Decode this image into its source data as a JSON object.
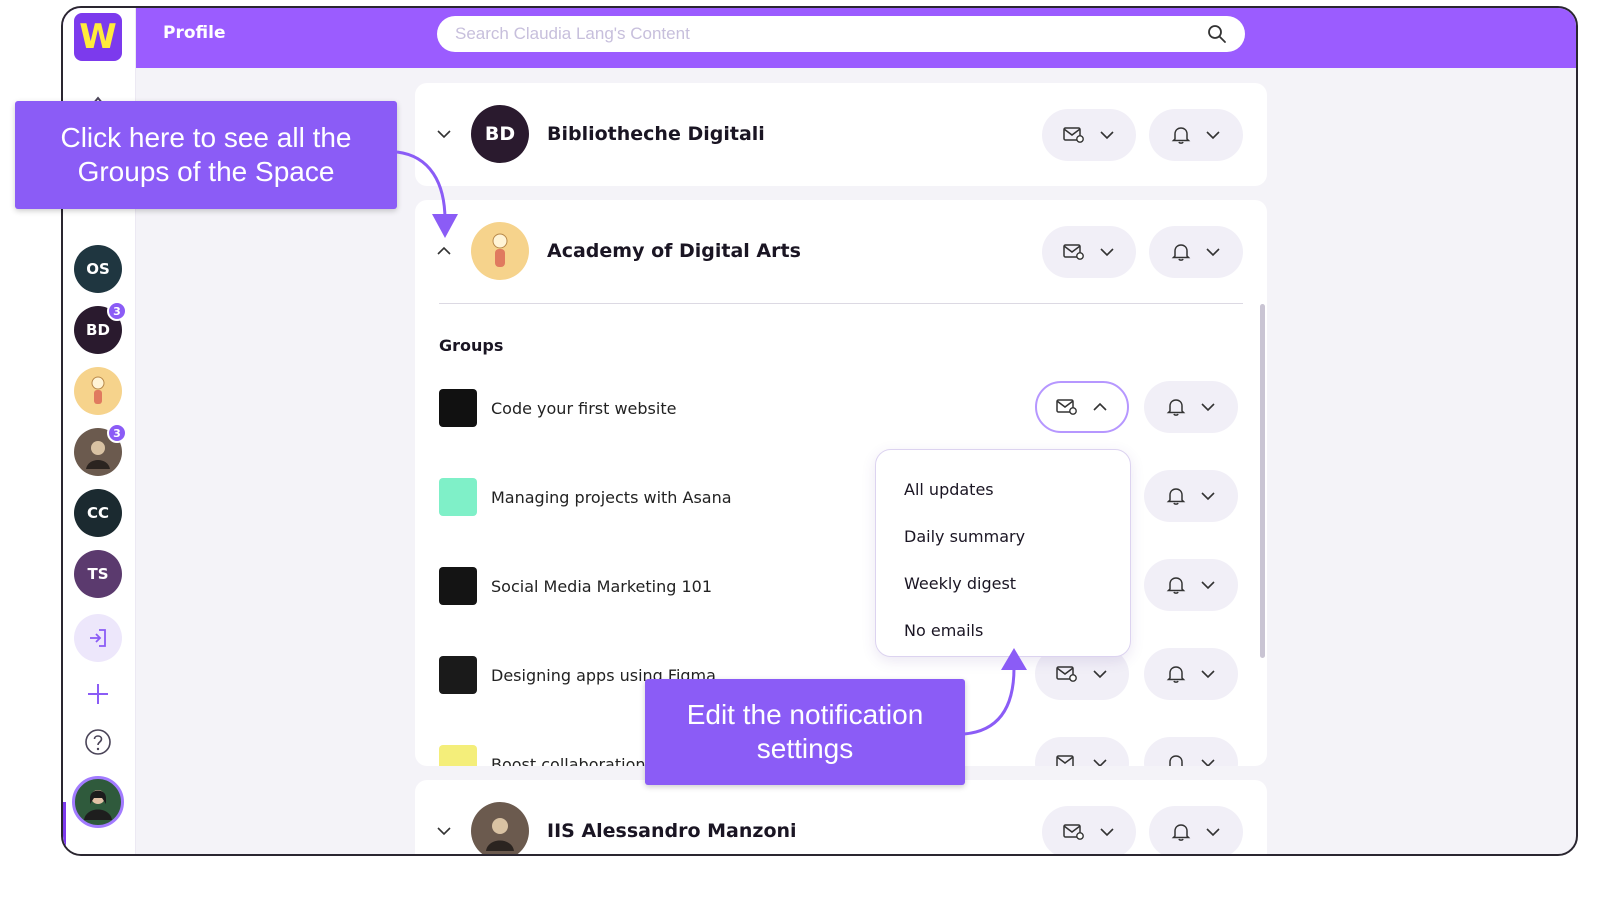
{
  "header": {
    "logo_letter": "W",
    "page_title": "Profile",
    "search_placeholder": "Search Claudia Lang's Content"
  },
  "sidebar": {
    "spaces": [
      {
        "initials": "OS",
        "color": "#1f3640",
        "badge": ""
      },
      {
        "initials": "BD",
        "color": "#2a1a2e",
        "badge": "3"
      },
      {
        "initials": "",
        "color": "#f6d38c",
        "badge": ""
      },
      {
        "initials": "",
        "color": "#6b5a4e",
        "badge": "3"
      },
      {
        "initials": "CC",
        "color": "#1b2a30",
        "badge": ""
      },
      {
        "initials": "TS",
        "color": "#5b3a6e",
        "badge": ""
      }
    ]
  },
  "spaces": [
    {
      "initials": "BD",
      "name": "Bibliotheche Digitali",
      "expanded": false
    },
    {
      "initials": "",
      "name": "Academy of Digital Arts",
      "expanded": true
    },
    {
      "initials": "",
      "name": "IIS Alessandro Manzoni",
      "expanded": false
    }
  ],
  "groups_title": "Groups",
  "groups": [
    {
      "name": "Code your first website",
      "thumb": "#111111"
    },
    {
      "name": "Managing projects with Asana",
      "thumb": "#7ff0c8"
    },
    {
      "name": "Social Media Marketing 101",
      "thumb": "#141414"
    },
    {
      "name": "Designing apps using Figma",
      "thumb": "#1a1a1a"
    },
    {
      "name": "Boost collaboration",
      "thumb": "#f4ee7a"
    }
  ],
  "email_dropdown": {
    "options": [
      "All updates",
      "Daily summary",
      "Weekly digest",
      "No emails"
    ]
  },
  "callouts": {
    "groups": "Click here to see all the Groups of the Space",
    "notifications": "Edit the notification settings"
  },
  "colors": {
    "brand": "#9b5cff",
    "accent": "#8b5cf6",
    "logo_letter": "#ffeb3b"
  }
}
